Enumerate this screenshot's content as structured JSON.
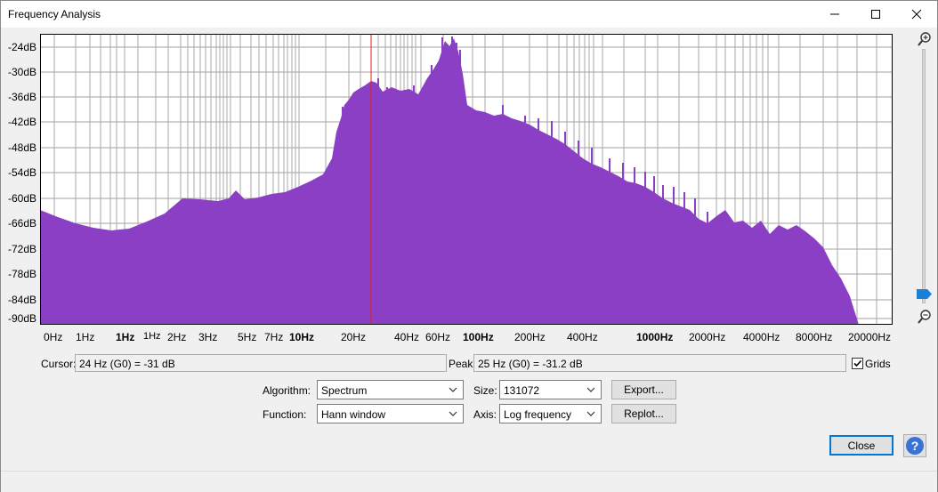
{
  "window": {
    "title": "Frequency Analysis"
  },
  "plot": {
    "y_labels": [
      "-24dB",
      "-30dB",
      "-36dB",
      "-42dB",
      "-48dB",
      "-54dB",
      "-60dB",
      "-66dB",
      "-72dB",
      "-78dB",
      "-84dB",
      "-90dB"
    ],
    "x_labels": [
      {
        "text": "0Hz",
        "bold": false
      },
      {
        "text": "1Hz",
        "bold": false
      },
      {
        "text": "1Hz",
        "bold": true
      },
      {
        "text": "1Hz",
        "bold": false,
        "small": true
      },
      {
        "text": "2Hz",
        "bold": false
      },
      {
        "text": "3Hz",
        "bold": false
      },
      {
        "text": "5Hz",
        "bold": false
      },
      {
        "text": "7Hz",
        "bold": false
      },
      {
        "text": "10Hz",
        "bold": true
      },
      {
        "text": "20Hz",
        "bold": false
      },
      {
        "text": "40Hz",
        "bold": false
      },
      {
        "text": "60Hz",
        "bold": false
      },
      {
        "text": "100Hz",
        "bold": true
      },
      {
        "text": "200Hz",
        "bold": false
      },
      {
        "text": "400Hz",
        "bold": false
      },
      {
        "text": "1000Hz",
        "bold": true
      },
      {
        "text": "2000Hz",
        "bold": false
      },
      {
        "text": "4000Hz",
        "bold": false
      },
      {
        "text": "8000Hz",
        "bold": false
      },
      {
        "text": "20000Hz",
        "bold": false
      }
    ],
    "spectrum_color": "#8a3fc5",
    "cursor_color": "#e02020"
  },
  "readout": {
    "cursor_label": "Cursor:",
    "cursor_value": "24 Hz (G0) = -31 dB",
    "peak_label": "Peak:",
    "peak_value": "25 Hz (G0) = -31.2 dB",
    "grids_label": "Grids",
    "grids_checked": true
  },
  "controls": {
    "algorithm_label": "Algorithm:",
    "algorithm_value": "Spectrum",
    "function_label": "Function:",
    "function_value": "Hann window",
    "size_label": "Size:",
    "size_value": "131072",
    "axis_label": "Axis:",
    "axis_value": "Log frequency",
    "export_label": "Export...",
    "replot_label": "Replot...",
    "close_label": "Close"
  },
  "icons": {
    "zoom_in": "zoom-in-icon",
    "zoom_out": "zoom-out-icon",
    "help": "help-icon"
  },
  "colors": {
    "accent": "#0078d7",
    "slider_thumb": "#1e7fd6"
  }
}
